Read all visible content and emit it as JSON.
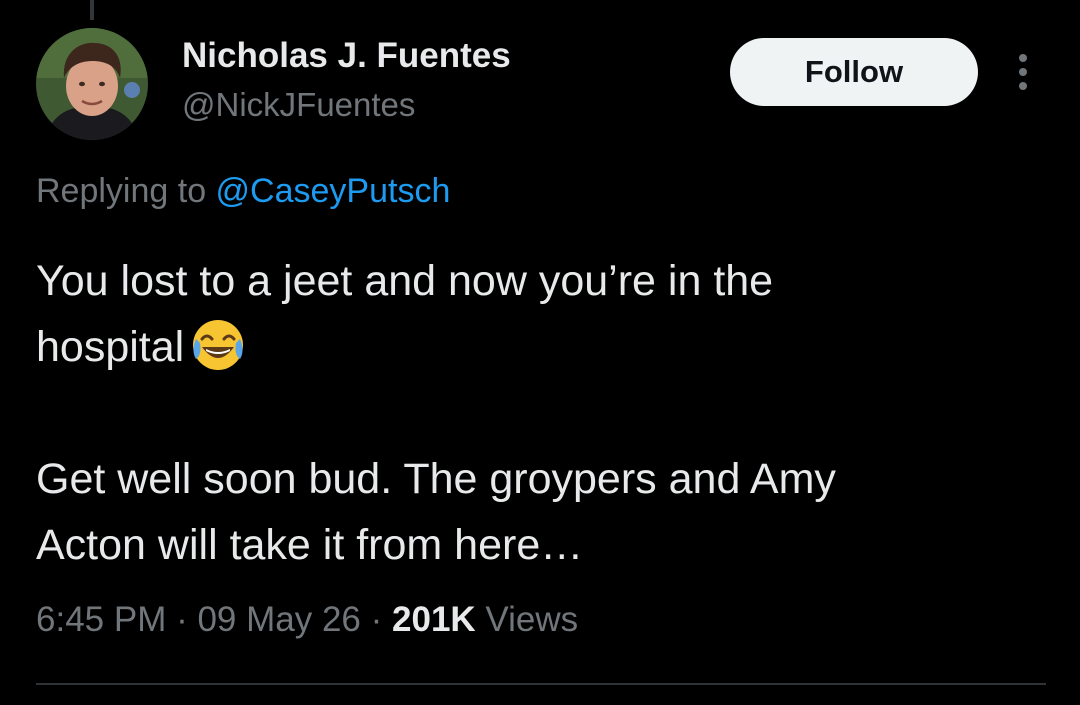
{
  "author": {
    "display_name": "Nicholas J. Fuentes",
    "handle": "@NickJFuentes",
    "avatar_icon": "profile-photo"
  },
  "header": {
    "follow_label": "Follow",
    "more_icon": "more-vertical-icon"
  },
  "reply": {
    "prefix": "Replying to ",
    "mention": "@CaseyPutsch"
  },
  "tweet": {
    "line1": "You lost to a jeet and now you’re in the",
    "line2": "hospital",
    "emoji": "face-with-tears-of-joy",
    "line3": "Get well soon bud. The groypers and Amy",
    "line4": "Acton will take it from here…"
  },
  "meta": {
    "time": "6:45 PM",
    "sep1": " · ",
    "date": "09 May 26",
    "sep2": " · ",
    "views_count": "201K",
    "views_label": " Views"
  },
  "colors": {
    "background": "#000000",
    "primary_text": "#e7e9ea",
    "secondary_text": "#71767b",
    "link": "#1d9bf0",
    "follow_bg": "#eff3f4"
  }
}
